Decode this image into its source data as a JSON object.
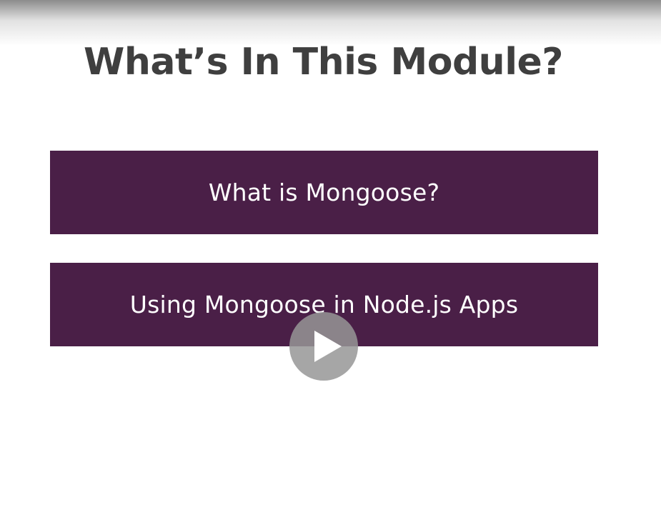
{
  "slide": {
    "title": "What’s In This Module?",
    "topics": [
      {
        "label": "What is Mongoose?"
      },
      {
        "label": "Using Mongoose in Node.js Apps"
      }
    ]
  },
  "player": {
    "play_icon": "play-icon",
    "colors": {
      "topic_background": "#4a1f47",
      "title_text": "#3f3f3f",
      "play_button": "#969696"
    }
  }
}
